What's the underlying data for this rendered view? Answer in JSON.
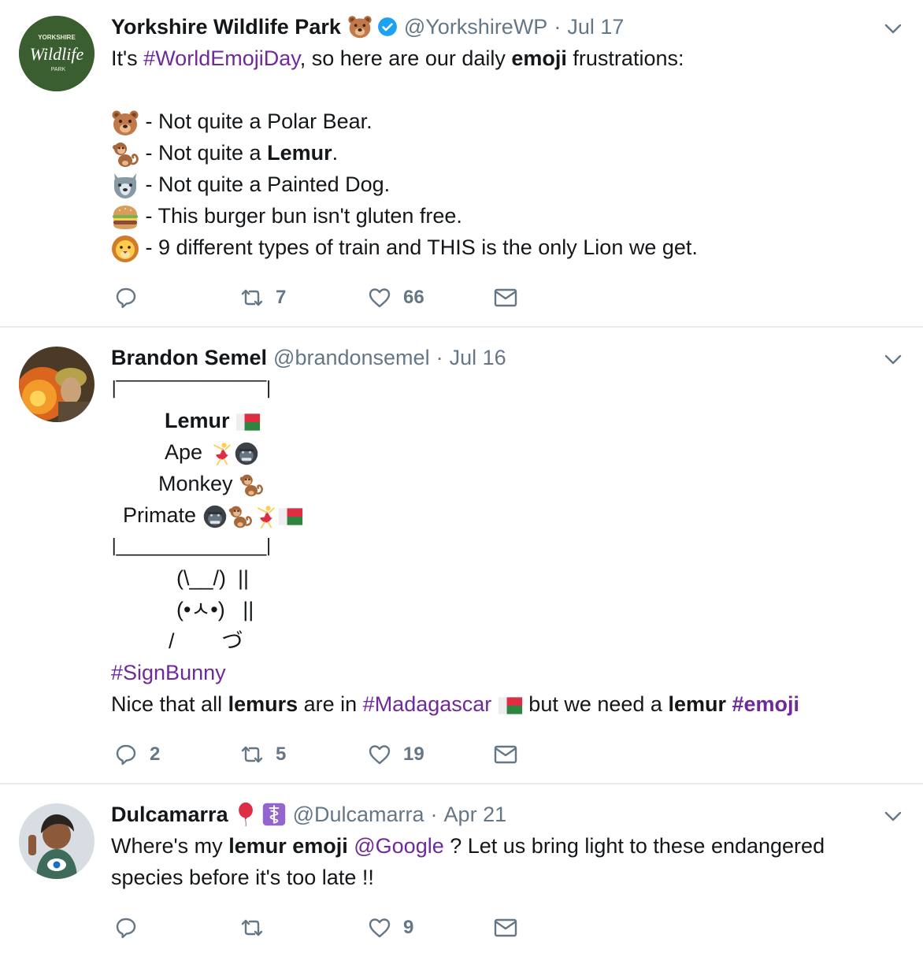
{
  "tweets": [
    {
      "name": "Yorkshire Wildlife Park",
      "handle": "@YorkshireWP",
      "date": "Jul 17",
      "avatar_text": [
        "YORKSHIRE",
        "Wildlife",
        "PARK"
      ],
      "text": {
        "intro_1": "It's ",
        "hashtag": "#WorldEmojiDay",
        "intro_2": ", so here are our daily ",
        "intro_bold": "emoji",
        "intro_3": " frustrations:",
        "items": [
          {
            "icon": "bear-emoji",
            "pre": " - Not quite a Polar Bear.",
            "bold": "",
            "post": ""
          },
          {
            "icon": "monkey-emoji",
            "pre": " - Not quite a ",
            "bold": "Lemur",
            "post": "."
          },
          {
            "icon": "wolf-emoji",
            "pre": " - Not quite a Painted Dog.",
            "bold": "",
            "post": ""
          },
          {
            "icon": "burger-emoji",
            "pre": " - This burger bun isn't gluten free.",
            "bold": "",
            "post": ""
          },
          {
            "icon": "lion-emoji",
            "pre": " - 9 different types of train and THIS is the only Lion we get.",
            "bold": "",
            "post": ""
          }
        ]
      },
      "actions": {
        "reply": "",
        "retweet": "7",
        "like": "66"
      }
    },
    {
      "name": "Brandon Semel",
      "handle": "@brandonsemel",
      "date": "Jul 16",
      "text": {
        "top": "|‾‾‾‾‾‾‾‾‾‾‾‾‾‾‾‾‾‾‾|",
        "lemur": "Lemur",
        "ape": "Ape",
        "monkey": "Monkey",
        "primate": "Primate",
        "bottom": "|___________________|",
        "bunny1": "(\\__/)  ||",
        "bunny2": "(•ㅅ•)   ||",
        "bunny3": "/        づ",
        "hashtag": "#SignBunny",
        "last_1": "Nice that all ",
        "last_bold1": "lemurs",
        "last_2": " are in ",
        "last_tag1": "#Madagascar",
        "last_3": " but we need a ",
        "last_bold2": "lemur",
        "last_tag2": "#emoji"
      },
      "actions": {
        "reply": "2",
        "retweet": "5",
        "like": "19"
      }
    },
    {
      "name": "Dulcamarra",
      "handle": "@Dulcamarra",
      "date": "Apr 21",
      "text": {
        "l1_1": "Where's my ",
        "l1_bold": "lemur emoji",
        "l1_mention": "@Google",
        "l1_2": " ? Let us bring light to these endangered",
        "l2": "species before it's too late !!"
      },
      "actions": {
        "reply": "",
        "retweet": "",
        "like": "9"
      }
    }
  ],
  "icons": {
    "reply": "reply-icon",
    "retweet": "retweet-icon",
    "like": "heart-icon",
    "dm": "envelope-icon",
    "caret": "chevron-down-icon",
    "verified": "verified-badge-icon"
  },
  "colors": {
    "hashtag": "#6e2a9a",
    "muted": "#657786",
    "verified": "#1da1f2",
    "divider": "#e6ecf0"
  }
}
